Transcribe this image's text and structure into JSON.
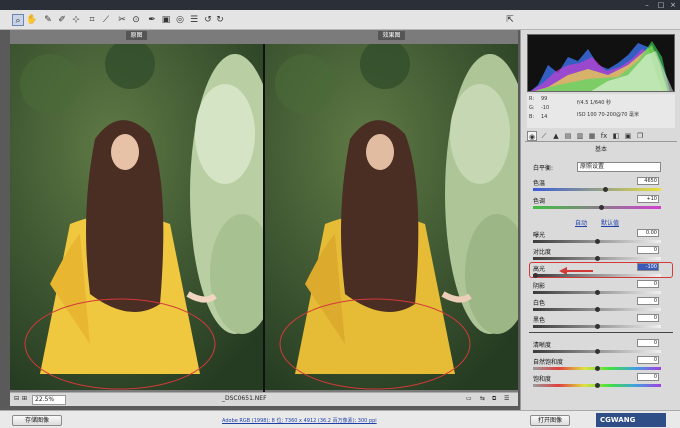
{
  "titlebar": {
    "title": ""
  },
  "toolbar": {
    "tools": [
      "zoom-tool",
      "hand-tool",
      "white-balance-tool",
      "color-sampler-tool",
      "targeted-adjustment-tool",
      "crop-tool",
      "straighten-tool",
      "spot-removal-tool",
      "red-eye-tool",
      "adjustment-brush-tool",
      "graduated-filter-tool",
      "radial-filter-tool",
      "preferences",
      "rotate-ccw",
      "rotate-cw"
    ]
  },
  "preview": {
    "before_label": "原图",
    "after_label": "效果图"
  },
  "status": {
    "zoom": "22.5%",
    "filename": "_DSC0651.NEF"
  },
  "bottom": {
    "save_label": "存储图像",
    "info_link": "Adobe RGB (1998); 8 位; 7360 x 4912 (36.2 百万像素); 300 ppi",
    "open_label": "打开图像",
    "brand": "CGWANG"
  },
  "panel": {
    "meta": {
      "r": "R:",
      "g": "G:",
      "b": "B:",
      "r_val": "99",
      "g_val": "-10",
      "b_val": "14",
      "exposure": "f/4.5  1/640 秒",
      "iso": "ISO 100  70-200@70 毫米"
    },
    "section_title": "基本",
    "wb_label": "白平衡:",
    "wb_value": "原照设置",
    "temp_label": "色温",
    "temp_value": "4650",
    "tint_label": "色调",
    "tint_value": "+10",
    "auto": "自动",
    "default": "默认值",
    "rows": [
      {
        "label": "曝光",
        "value": "0.00"
      },
      {
        "label": "对比度",
        "value": "0"
      },
      {
        "label": "高光",
        "value": "-100"
      },
      {
        "label": "阴影",
        "value": "0"
      },
      {
        "label": "白色",
        "value": "0"
      },
      {
        "label": "黑色",
        "value": "0"
      }
    ],
    "rows2": [
      {
        "label": "清晰度",
        "value": "0"
      },
      {
        "label": "自然饱和度",
        "value": "0"
      },
      {
        "label": "饱和度",
        "value": "0"
      }
    ]
  },
  "colors": {
    "accent": "#d23a3a",
    "selection": "#3a5bb8",
    "link": "#1d3fa8"
  }
}
